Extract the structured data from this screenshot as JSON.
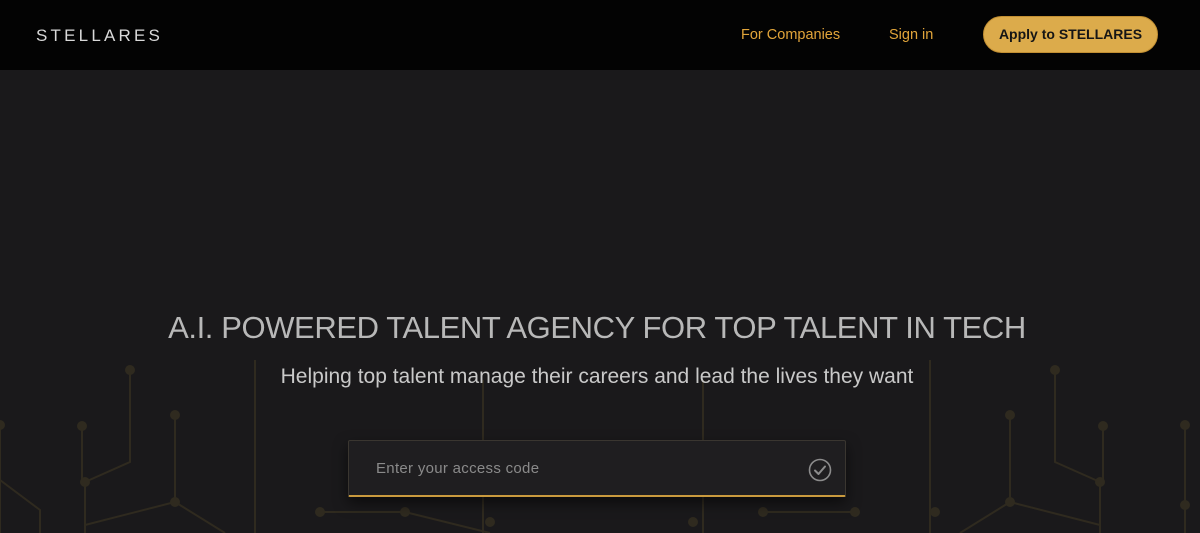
{
  "header": {
    "logo": "STELLARES",
    "nav": {
      "for_companies": "For Companies",
      "sign_in": "Sign in",
      "apply": "Apply to STELLARES"
    }
  },
  "hero": {
    "title": "A.I. POWERED TALENT AGENCY FOR TOP TALENT IN TECH",
    "subtitle": "Helping top talent manage their careers and lead the lives they want"
  },
  "access_form": {
    "placeholder": "Enter your access code",
    "value": "",
    "submit_icon": "check-circle-icon"
  },
  "colors": {
    "accent": "#e2a53a",
    "button": "#dcab4b",
    "header_bg": "#030303",
    "page_bg": "#1a191b"
  }
}
